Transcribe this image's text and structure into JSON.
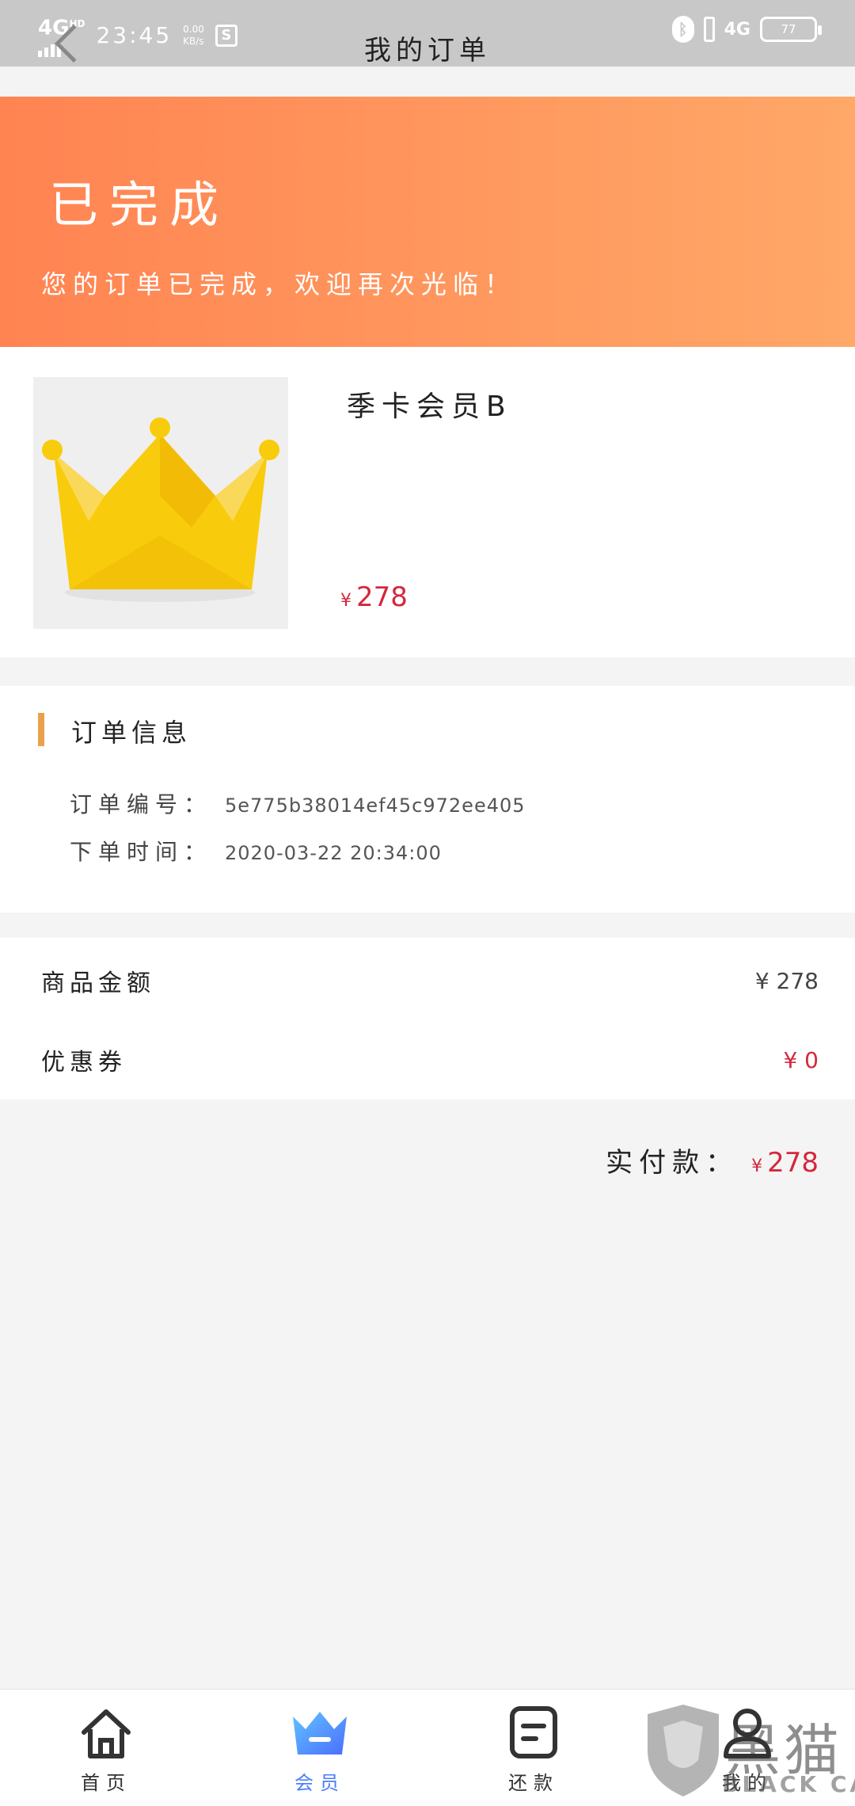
{
  "status_bar": {
    "network": "4G",
    "network_sup": "HD",
    "time": "23:45",
    "speed_value": "0.00",
    "speed_unit": "KB/s",
    "screenshot_glyph": "S",
    "bluetooth_glyph": "ᛒ",
    "mobile_network": "4G",
    "battery": "77"
  },
  "nav": {
    "title": "我的订单",
    "back_icon": "chevron-left-icon"
  },
  "banner": {
    "title": "已完成",
    "subtitle": "您的订单已完成，欢迎再次光临！",
    "gradient_start": "#ff8452",
    "gradient_end": "#ffa868"
  },
  "product": {
    "name": "季卡会员B",
    "currency": "¥",
    "price": "278",
    "thumbnail_icon": "crown-icon"
  },
  "order_info": {
    "heading": "订单信息",
    "rows": [
      {
        "label": "订单编号：",
        "value": "5e775b38014ef45c972ee405"
      },
      {
        "label": "下单时间：",
        "value": "2020-03-22 20:34:00"
      }
    ]
  },
  "amounts": [
    {
      "label": "商品金额",
      "value": "¥ 278",
      "highlight": false
    },
    {
      "label": "优惠券",
      "value": "¥ 0",
      "highlight": true
    }
  ],
  "payment": {
    "label": "实付款：",
    "currency": "¥",
    "value": "278"
  },
  "tab_bar": {
    "tabs": [
      {
        "label": "首页",
        "icon": "home-icon",
        "active": false
      },
      {
        "label": "会员",
        "icon": "crown-icon",
        "active": true
      },
      {
        "label": "还款",
        "icon": "document-icon",
        "active": false
      },
      {
        "label": "我的",
        "icon": "user-icon",
        "active": false
      }
    ]
  },
  "watermark": {
    "text": "BLACK CAT",
    "glyph": "黑猫"
  },
  "colors": {
    "accent": "#4a7dff",
    "price_red": "#d3283c",
    "section_bar": "#e9a24c"
  }
}
